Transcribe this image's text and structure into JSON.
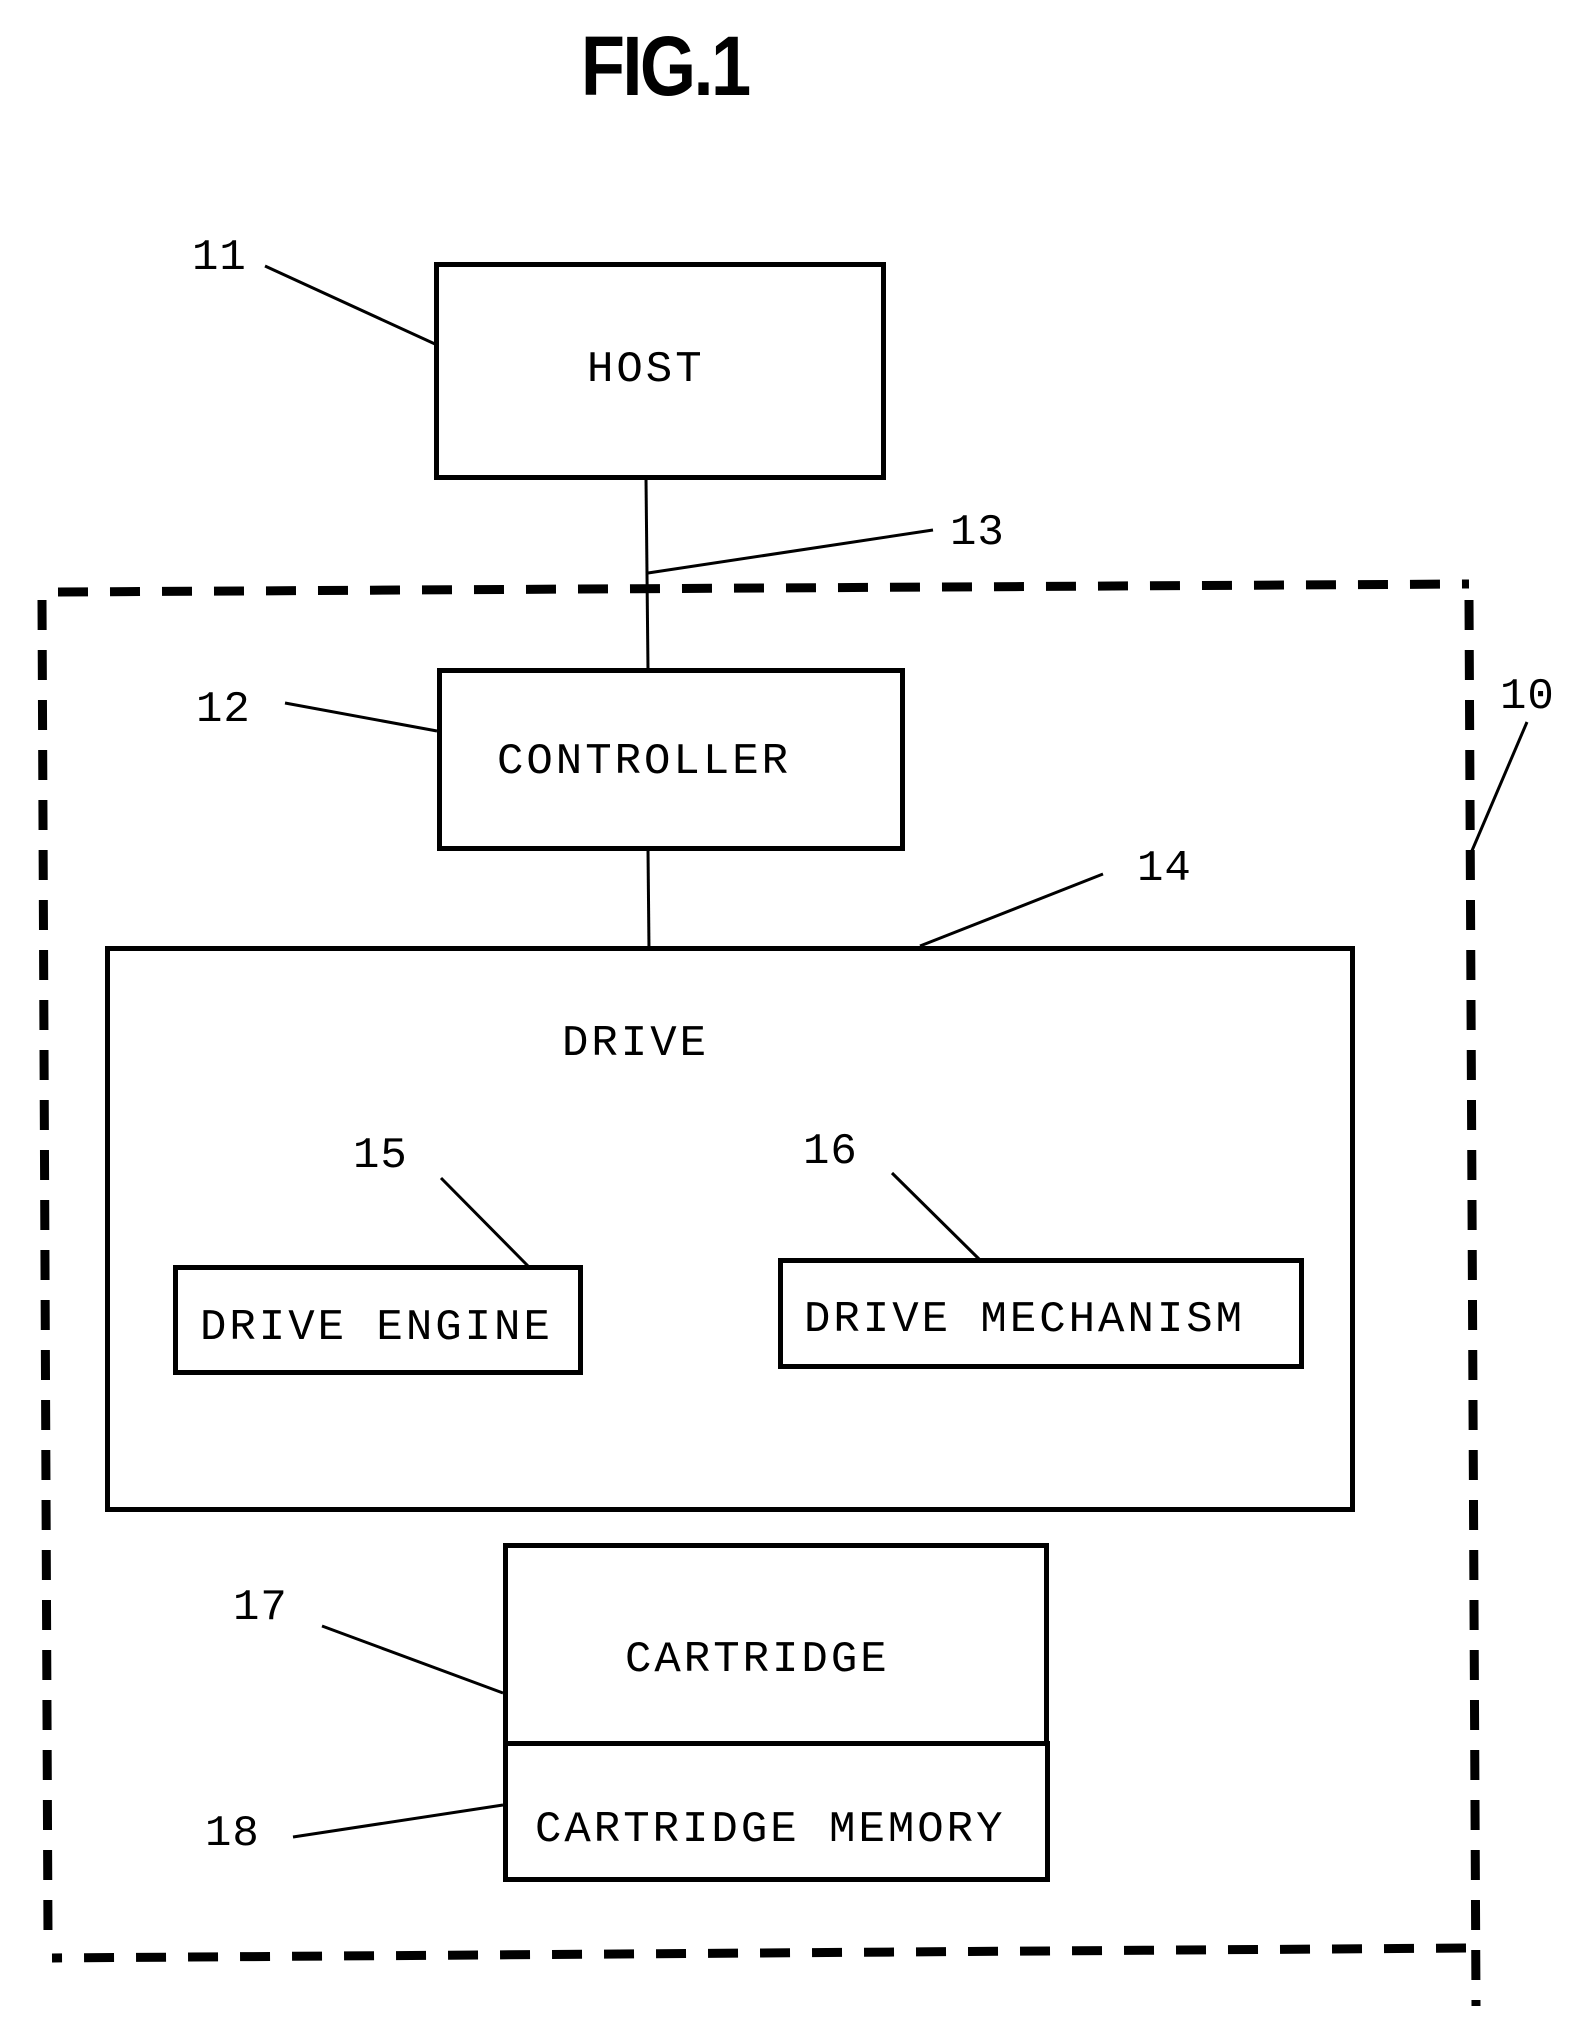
{
  "figure": {
    "title": "FIG.1",
    "boxes": {
      "host": "HOST",
      "controller": "CONTROLLER",
      "drive": "DRIVE",
      "drive_engine": "DRIVE ENGINE",
      "drive_mechanism": "DRIVE MECHANISM",
      "cartridge": "CARTRIDGE",
      "cartridge_memory": "CARTRIDGE MEMORY"
    },
    "reference_numerals": {
      "system": "10",
      "host": "11",
      "controller": "12",
      "host_link": "13",
      "drive": "14",
      "drive_engine": "15",
      "drive_mechanism": "16",
      "cartridge": "17",
      "cartridge_memory": "18"
    },
    "colors": {
      "ink": "#000000",
      "paper": "#ffffff"
    }
  }
}
